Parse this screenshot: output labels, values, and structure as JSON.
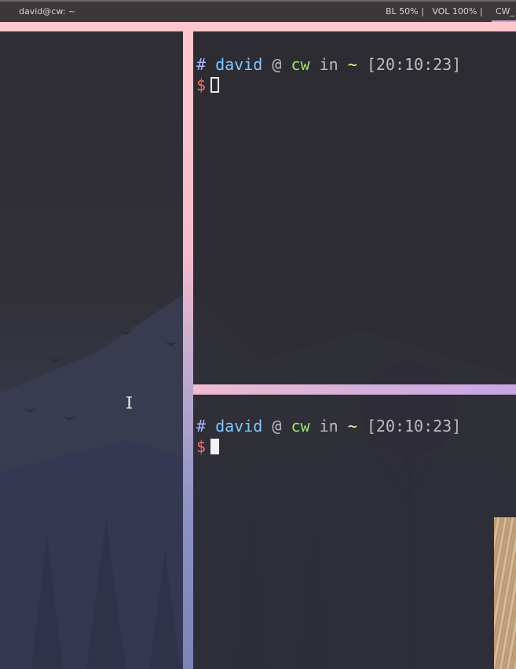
{
  "topbar": {
    "window_title": "david@cw: ~",
    "status_text": "BL 50% |   VOL 100% |",
    "workspace_label": "CW_"
  },
  "terminals": [
    {
      "prompt": {
        "hash": "#",
        "user": "david",
        "at": "@",
        "host": "cw",
        "in": "in",
        "path": "~",
        "time": "[20:10:23]",
        "symbol": "$"
      },
      "focused": false
    },
    {
      "prompt": {
        "hash": "#",
        "user": "david",
        "at": "@",
        "host": "cw",
        "in": "in",
        "path": "~",
        "time": "[20:10:23]",
        "symbol": "$"
      },
      "focused": true
    }
  ],
  "colors": {
    "border_pink": "#ffc7cc",
    "border_lavender": "#c7a6e3",
    "prompt_user": "#7fc7ff",
    "prompt_host": "#9be56f",
    "prompt_path": "#fff59a",
    "prompt_symbol": "#ff6a6a"
  }
}
